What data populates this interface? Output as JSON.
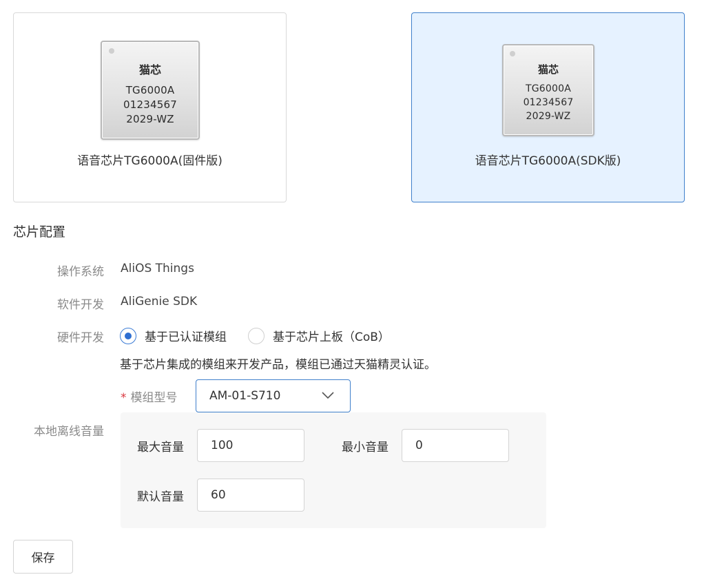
{
  "chips": [
    {
      "brand": "猫芯",
      "model": "TG6000A",
      "serial": "01234567",
      "code": "2029-WZ",
      "title": "语音芯片TG6000A(固件版)",
      "selected": false
    },
    {
      "brand": "猫芯",
      "model": "TG6000A",
      "serial": "01234567",
      "code": "2029-WZ",
      "title": "语音芯片TG6000A(SDK版)",
      "selected": true
    }
  ],
  "config": {
    "section_title": "芯片配置",
    "os_label": "操作系统",
    "os_value": "AliOS Things",
    "software_label": "软件开发",
    "software_value": "AliGenie SDK",
    "hardware_label": "硬件开发",
    "hardware_options": [
      {
        "label": "基于已认证模组",
        "checked": true
      },
      {
        "label": "基于芯片上板（CoB）",
        "checked": false
      }
    ],
    "hardware_hint": "基于芯片集成的模组来开发产品，模组已通过天猫精灵认证。",
    "module_label": "模组型号",
    "module_required_mark": "*",
    "module_value": "AM-01-S710",
    "volume_label": "本地离线音量",
    "max_volume_label": "最大音量",
    "max_volume_value": "100",
    "min_volume_label": "最小音量",
    "min_volume_value": "0",
    "default_volume_label": "默认音量",
    "default_volume_value": "60"
  },
  "save_label": "保存",
  "colors": {
    "accent": "#3e7fcb",
    "selected_bg": "#e6f2ff",
    "required": "#d9363e"
  }
}
